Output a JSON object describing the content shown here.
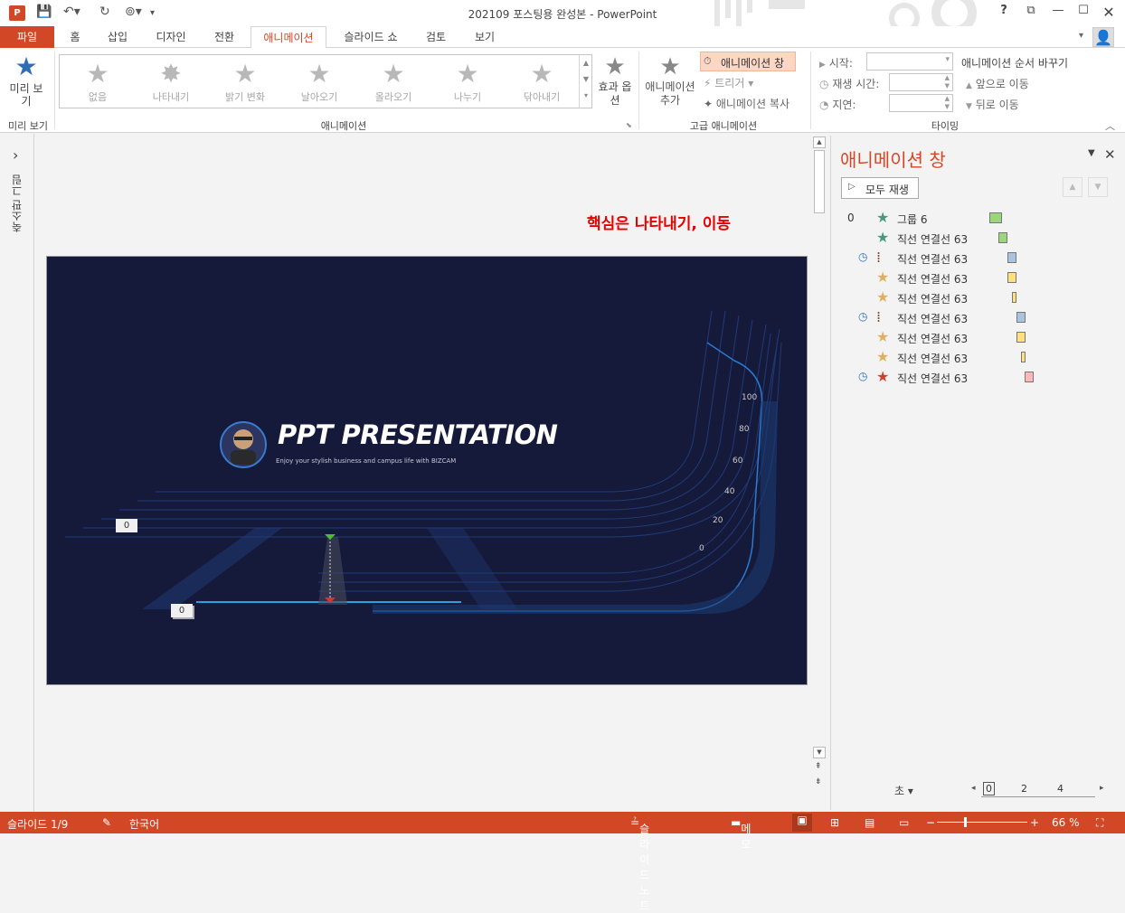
{
  "titlebar": {
    "title": "202109 포스팅용 완성본 - PowerPoint",
    "help": "?",
    "restore_icon": "⧉"
  },
  "tabs": [
    {
      "label": "파일"
    },
    {
      "label": "홈"
    },
    {
      "label": "삽입"
    },
    {
      "label": "디자인"
    },
    {
      "label": "전환"
    },
    {
      "label": "애니메이션"
    },
    {
      "label": "슬라이드 쇼"
    },
    {
      "label": "검토"
    },
    {
      "label": "보기"
    }
  ],
  "ribbon": {
    "preview": {
      "label": "미리 보기",
      "group": "미리 보기"
    },
    "gallery": {
      "items": [
        "없음",
        "나타내기",
        "밝기 변화",
        "날아오기",
        "올라오기",
        "나누기",
        "닦아내기"
      ],
      "group": "애니메이션"
    },
    "effect_options": "효과 옵션",
    "advanced": {
      "add_animation": "애니메이션 추가",
      "animation_pane": "애니메이션 창",
      "trigger": "트리거",
      "painter": "애니메이션 복사",
      "group": "고급 애니메이션"
    },
    "timing": {
      "start": "시작:",
      "duration": "재생 시간:",
      "delay": "지연:",
      "reorder": "애니메이션 순서 바꾸기",
      "move_earlier": "앞으로 이동",
      "move_later": "뒤로 이동",
      "group": "타이밍"
    }
  },
  "leftpanel": {
    "label": "축소판 그림",
    "expand": "›"
  },
  "editor": {
    "annotation": "핵심은 나타내기, 이동",
    "annotation_color": "#e60000"
  },
  "slide": {
    "title": "PPT PRESENTATION",
    "subtitle": "Enjoy your stylish business and campus life with BIZCAM",
    "scale": [
      "100",
      "80",
      "60",
      "40",
      "20",
      "0"
    ],
    "badge_left": "0",
    "badge_bottom": "0",
    "background": "#161a3a",
    "accent": "#1e6fd9"
  },
  "anpane": {
    "title": "애니메이션 창",
    "play_all": "모두 재생",
    "items": [
      {
        "num": "0",
        "clock": "",
        "icon": "★",
        "color": "#4a9a7a",
        "label": "그룹 6",
        "bar": "#9ad77a"
      },
      {
        "num": "",
        "clock": "",
        "icon": "★",
        "color": "#4a9a7a",
        "label": "직선 연결선 63",
        "bar": "#9ad77a"
      },
      {
        "num": "",
        "clock": "◷",
        "icon": "⁞",
        "color": "#8b4a2a",
        "label": "직선 연결선 63",
        "bar": "#a8c4e0"
      },
      {
        "num": "",
        "clock": "",
        "icon": "★",
        "color": "#e0b060",
        "label": "직선 연결선 63",
        "bar": "#ffe07a"
      },
      {
        "num": "",
        "clock": "",
        "icon": "★",
        "color": "#e0b060",
        "label": "직선 연결선 63",
        "bar": "#ffe07a"
      },
      {
        "num": "",
        "clock": "◷",
        "icon": "⁞",
        "color": "#8b4a2a",
        "label": "직선 연결선 63",
        "bar": "#a8c4e0"
      },
      {
        "num": "",
        "clock": "",
        "icon": "★",
        "color": "#e0b060",
        "label": "직선 연결선 63",
        "bar": "#ffe07a"
      },
      {
        "num": "",
        "clock": "",
        "icon": "★",
        "color": "#e0b060",
        "label": "직선 연결선 63",
        "bar": "#ffe07a"
      },
      {
        "num": "",
        "clock": "◷",
        "icon": "★",
        "color": "#d0402a",
        "label": "직선 연결선 63",
        "bar": "#ffb8b8"
      }
    ],
    "seconds": "초",
    "timeline": [
      "0",
      "2",
      "4"
    ]
  },
  "statusbar": {
    "slide": "슬라이드 1/9",
    "language": "한국어",
    "notes": "슬라이드 노트",
    "comments": "메모",
    "zoom": "66 %"
  }
}
